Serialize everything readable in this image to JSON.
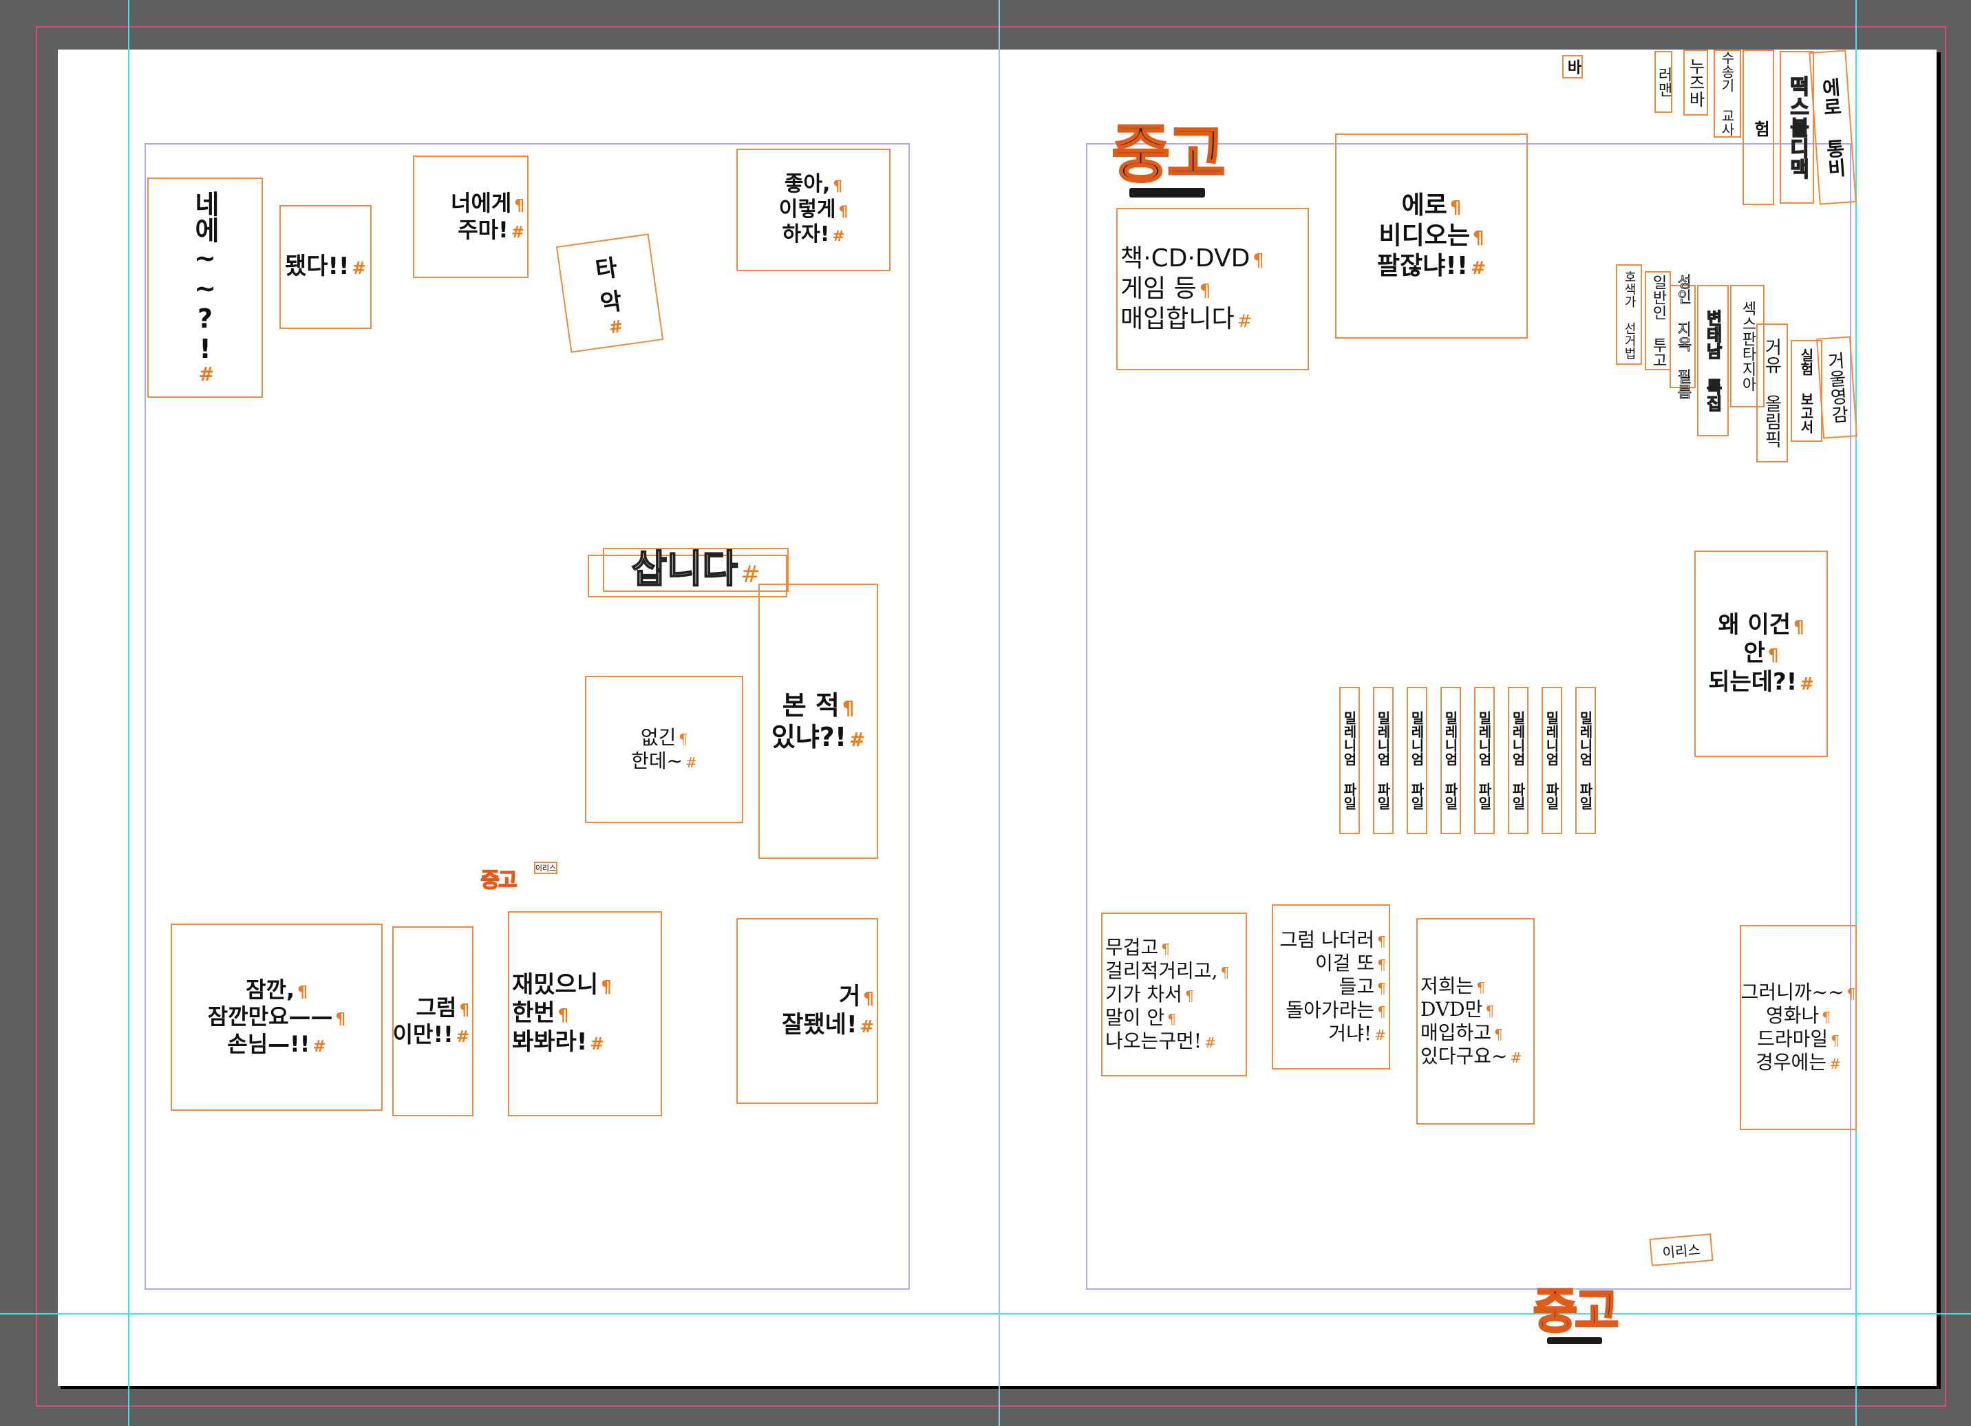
{
  "left_page": {
    "frames": [
      {
        "id": "nee",
        "lines": [
          "네",
          "에",
          "~",
          "~",
          "?!"
        ],
        "vertical": true
      },
      {
        "id": "dwaetda",
        "lines": [
          "됐다!!"
        ]
      },
      {
        "id": "neoege",
        "lines": [
          "너에게",
          "주마!"
        ]
      },
      {
        "id": "taak",
        "lines": [
          "타",
          "악"
        ]
      },
      {
        "id": "joha",
        "lines": [
          "좋아,",
          "이렇게",
          "하자!"
        ]
      },
      {
        "id": "sabnida",
        "lines": [
          "삽니다"
        ]
      },
      {
        "id": "eopgin",
        "lines": [
          "없긴",
          "한데~"
        ]
      },
      {
        "id": "bonjeok",
        "lines": [
          "본 적",
          "있냐?!"
        ]
      },
      {
        "id": "jamkkan",
        "lines": [
          "잠깐,",
          "잠깐만요——",
          "손님—!!"
        ]
      },
      {
        "id": "geureom",
        "lines": [
          "그럼",
          "이만!!"
        ]
      },
      {
        "id": "jaemit",
        "lines": [
          "재밌으니",
          "한번",
          "봐봐라!"
        ]
      },
      {
        "id": "geo",
        "lines": [
          "거",
          "잘됐네!"
        ]
      }
    ],
    "logo_small": "중고",
    "tag_small": "이리스"
  },
  "right_page": {
    "logo": "중고",
    "logo_bottom": "중고",
    "frames": [
      {
        "id": "chaek",
        "lines": [
          "책·CD·DVD",
          "게임 등",
          "매입합니다"
        ]
      },
      {
        "id": "ero",
        "lines": [
          "에로",
          "비디오는",
          "팔잖냐!!"
        ]
      },
      {
        "id": "wae",
        "lines": [
          "왜 이건",
          "안",
          "되는데?!"
        ]
      },
      {
        "id": "mugeopgo",
        "lines": [
          "무겁고",
          "걸리적거리고,",
          "기가 차서",
          "말이 안",
          "나오는구먼!"
        ]
      },
      {
        "id": "geureomnadeo",
        "lines": [
          "그럼 나더러",
          "이걸 또",
          "들고",
          "돌아가라는",
          "거냐!"
        ]
      },
      {
        "id": "jeohuineun",
        "lines": [
          "저희는",
          "DVD만",
          "매입하고",
          "있다구요~"
        ]
      },
      {
        "id": "geureonikka",
        "lines": [
          "그러니까~~",
          "영화나",
          "드라마일",
          "경우에는"
        ]
      }
    ],
    "top_spines": [
      "바",
      "러맨",
      "누즈바",
      "수송기 교사",
      "험",
      "떡스볼디맥",
      "에로 통비"
    ],
    "mid_spines": [
      "호색가 선거법",
      "일반인 투고",
      "성인 지옥 필름",
      "변태남 특집",
      "섹스판타지아",
      "거유 올림픽",
      "실험 보고서",
      "거울영감"
    ],
    "dvd_label": "밀레니엄 파일",
    "dvd_count": 8,
    "tag": "이리스"
  },
  "colors": {
    "pasteboard": "#5f5f5f",
    "frame": "#f08a3c",
    "guide": "#40e0ea",
    "margin": "#b8a6e6",
    "bleed": "#d94a78"
  },
  "icons": {
    "paragraph_mark": "¶",
    "end_mark": "#"
  }
}
